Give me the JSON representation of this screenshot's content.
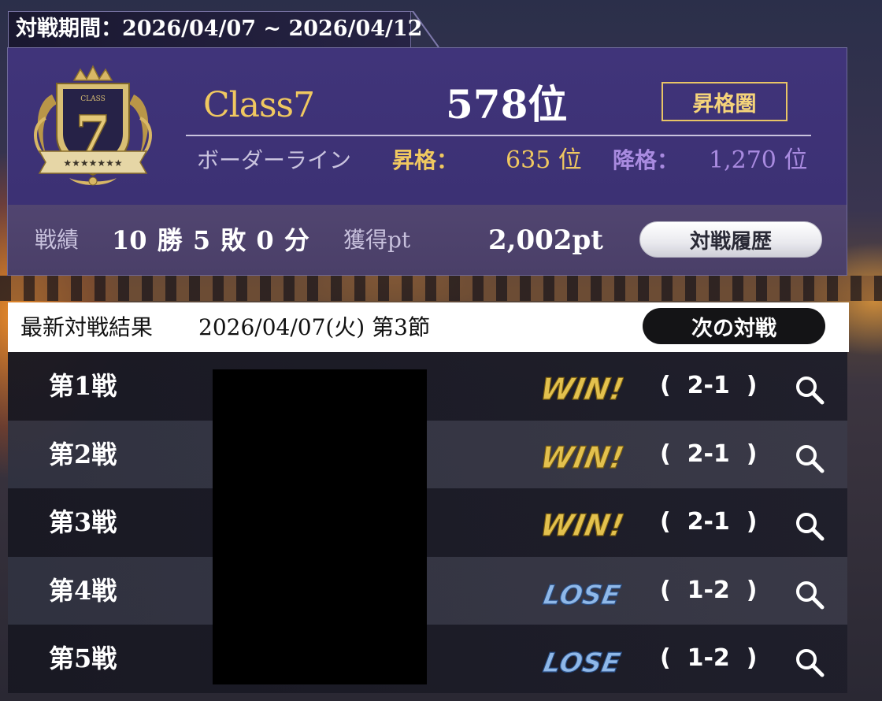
{
  "period": {
    "label": "対戦期間：2026/04/07 ~ 2026/04/12"
  },
  "class_info": {
    "emblem_text": "CLASS",
    "emblem_number": "7",
    "name": "Class7",
    "rank": "578位",
    "zone_badge": "昇格圏"
  },
  "border_line": {
    "label": "ボーダーライン",
    "promotion_label": "昇格：",
    "promotion_value": "635 位",
    "demotion_label": "降格：",
    "demotion_value": "1,270 位"
  },
  "stats": {
    "record_label": "戦績",
    "record_value": "10 勝 5 敗 0 分",
    "points_label": "獲得pt",
    "points_value": "2,002pt",
    "history_button": "対戦履歴"
  },
  "latest": {
    "title": "最新対戦結果",
    "date": "2026/04/07(火) 第3節",
    "next_button": "次の対戦"
  },
  "matches": [
    {
      "label": "第1戦",
      "result": "WIN!",
      "score": "(  2-1  )"
    },
    {
      "label": "第2戦",
      "result": "WIN!",
      "score": "(  2-1  )"
    },
    {
      "label": "第3戦",
      "result": "WIN!",
      "score": "(  2-1  )"
    },
    {
      "label": "第4戦",
      "result": "LOSE",
      "score": "(  1-2  )"
    },
    {
      "label": "第5戦",
      "result": "LOSE",
      "score": "(  1-2  )"
    }
  ],
  "colors": {
    "gold": "#f0c860",
    "purple_panel": "#3d3276",
    "demote_purple": "#a98be0",
    "lose_blue": "#8fb8e8"
  }
}
